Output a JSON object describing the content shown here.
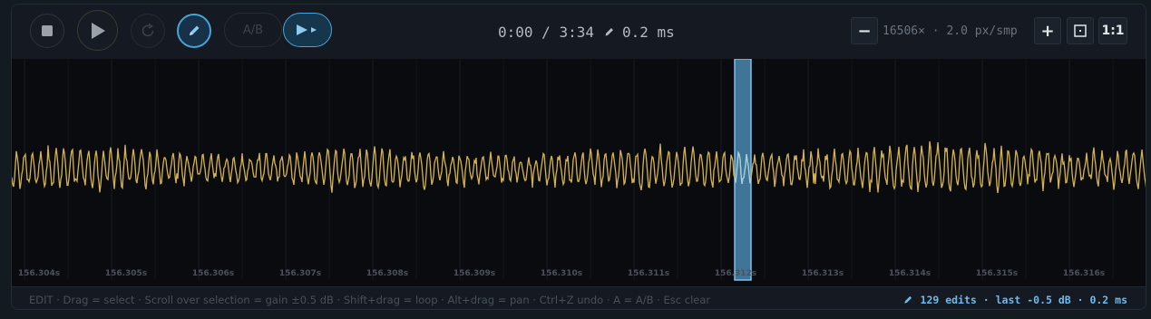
{
  "toolbar": {
    "ab_label": "A/B",
    "time_current": "0:00",
    "time_separator": " / ",
    "time_total": "3:34",
    "edit_resolution": "0.2 ms",
    "zoom_out_label": "−",
    "zoom_factor": "16506×",
    "zoom_separator": " · ",
    "samples_per_px": "2.0 px/smp",
    "zoom_in_label": "+",
    "one_to_one_label": "1:1"
  },
  "icons": {
    "stop": "stop-icon",
    "play": "play-icon",
    "loop": "loop-icon",
    "pencil": "pencil-icon",
    "play_selection": "play-selection-icon",
    "fit": "fit-icon"
  },
  "timeline": {
    "ticks": [
      "156.304s",
      "156.305s",
      "156.306s",
      "156.307s",
      "156.308s",
      "156.309s",
      "156.310s",
      "156.311s",
      "156.312s",
      "156.313s",
      "156.314s",
      "156.315s",
      "156.316s"
    ],
    "selection_label": "156.312s"
  },
  "status": {
    "help_text": "EDIT · Drag = select · Scroll over selection = gain ±0.5 dB · Shift+drag = loop · Alt+drag = pan · Ctrl+Z undo · A = A/B · Esc clear",
    "edit_summary": "129 edits · last -0.5 dB · 0.2 ms"
  },
  "colors": {
    "waveform": "#d4b250",
    "waveform_selected": "#9fd0ea",
    "selection_fill": "#4a88b0",
    "accent": "#4aa3d8"
  }
}
